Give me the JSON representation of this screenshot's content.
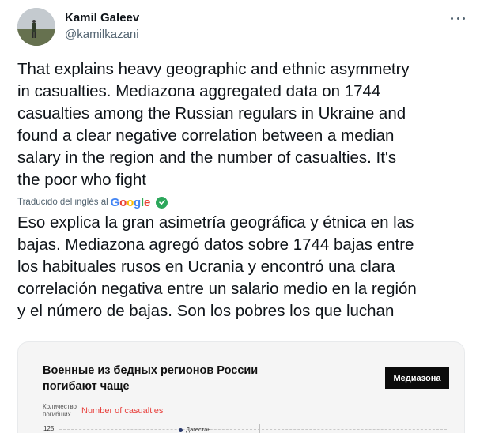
{
  "author": {
    "name": "Kamil Galeev",
    "handle": "@kamilkazani"
  },
  "tweet": {
    "text": "That explains heavy geographic and ethnic asymmetry\nin casualties. Mediazona aggregated data on 1744\ncasualties among the Russian regulars in Ukraine and\nfound a clear negative correlation between a median\nsalary in the region and the number of casualties. It's\nthe poor who fight"
  },
  "translation": {
    "label": "Traducido del inglés al",
    "provider": "Google",
    "text": "Eso explica la gran asimetría geográfica y étnica en las\nbajas. Mediazona agregó datos sobre 1744 bajas entre\nlos habituales rusos en Ucrania y encontró una clara\ncorrelación negativa entre un salario medio en la región\ny el número de bajas. Son los pobres los que luchan"
  },
  "media": {
    "title": "Военные из бедных регионов России\nпогибают чаще",
    "brand": "Медиазона",
    "ylabel_ru": "Количество погибших",
    "ylabel_en": "Number of casualties",
    "tick": "125",
    "point_label": "Дагестан"
  },
  "colors": {
    "text": "#0f1419",
    "muted": "#536471",
    "verified_green": "#2ca75b",
    "annotation_red": "#e8413d"
  },
  "icons": {
    "more": "more-horizontal-icon",
    "verified": "check-circle-icon"
  }
}
